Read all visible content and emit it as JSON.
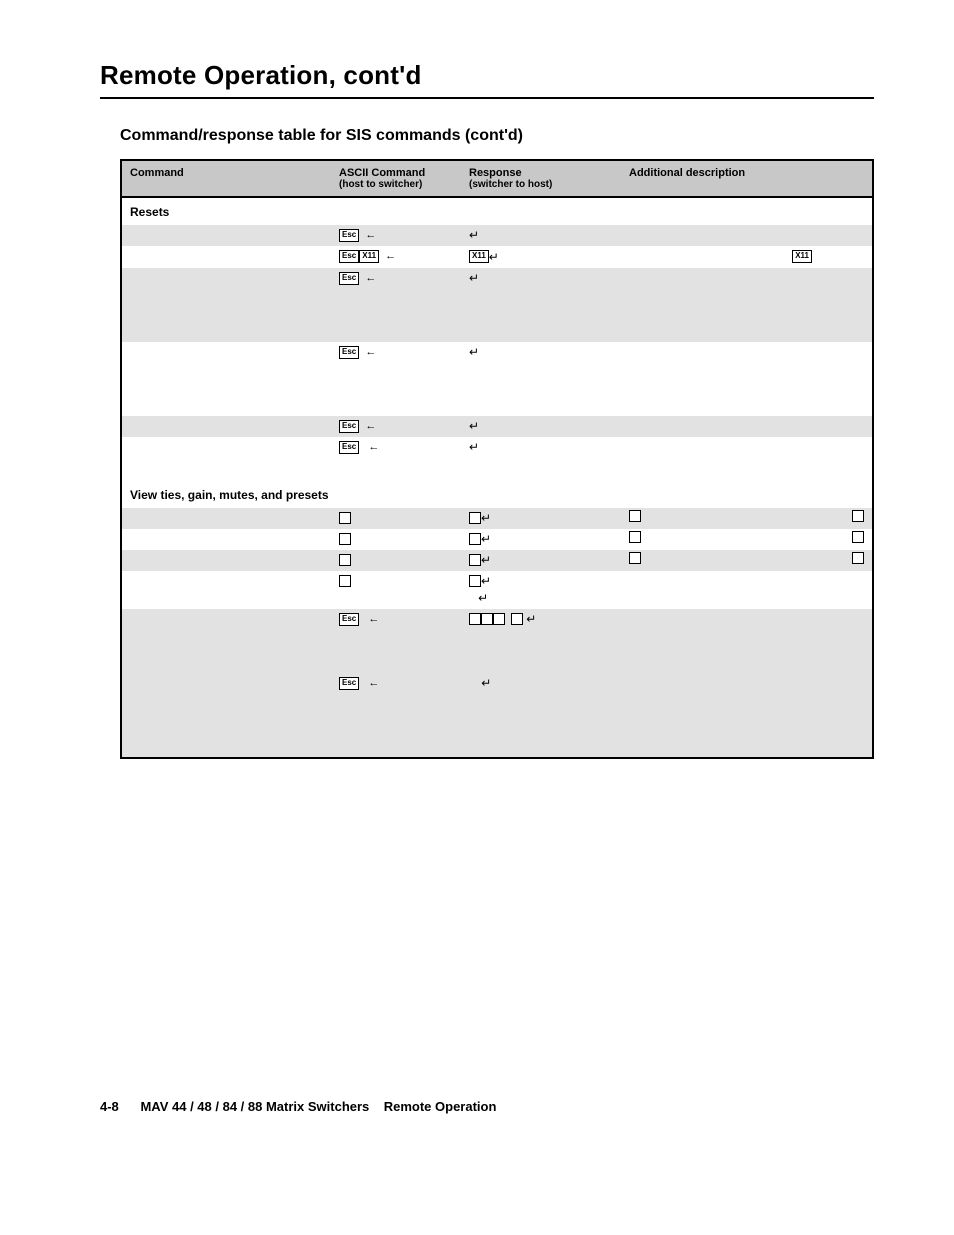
{
  "page_title": "Remote Operation, cont'd",
  "subtitle": "Command/response table for SIS commands (cont'd)",
  "headers": {
    "command": "Command",
    "ascii": "ASCII Command",
    "ascii_sub": "(host to switcher)",
    "response": "Response",
    "response_sub": "(switcher to host)",
    "desc": "Additional description"
  },
  "glyphs": {
    "esc": "Esc",
    "x11": "X11",
    "enter": "↵",
    "larrow": "←"
  },
  "sections": [
    {
      "label": "Resets"
    },
    {
      "label": "View ties, gain, mutes, and presets"
    }
  ],
  "footer": {
    "pg": "4-8",
    "product": "MAV 44 / 48 / 84 / 88 Matrix Switchers",
    "section": "Remote Operation"
  },
  "chart_data": {
    "type": "table",
    "title": "Command/response table for SIS commands (cont'd)",
    "columns": [
      "Command",
      "ASCII Command (host to switcher)",
      "Response (switcher to host)",
      "Additional description"
    ],
    "rows": [
      {
        "section": "Resets"
      },
      {
        "command": "",
        "ascii": "[Esc] ←",
        "response": "↵",
        "desc": ""
      },
      {
        "command": "",
        "ascii": "[Esc][X11] ←",
        "response": "[X11]↵",
        "desc": "[X11]"
      },
      {
        "command": "",
        "ascii": "[Esc] ←",
        "response": "↵",
        "desc": "",
        "multiline": 4
      },
      {
        "command": "",
        "ascii": "[Esc] ←",
        "response": "↵",
        "desc": "",
        "multiline": 4
      },
      {
        "command": "",
        "ascii": "[Esc] ←",
        "response": "↵",
        "desc": ""
      },
      {
        "command": "",
        "ascii": "[Esc] ←",
        "response": "↵",
        "desc": "",
        "multiline": 2
      },
      {
        "section": "View ties, gain, mutes, and presets"
      },
      {
        "command": "",
        "ascii": "□",
        "response": "□↵",
        "desc": "□ … □"
      },
      {
        "command": "",
        "ascii": "□",
        "response": "□↵",
        "desc": "□ … □"
      },
      {
        "command": "",
        "ascii": "□",
        "response": "□↵",
        "desc": "□ … □"
      },
      {
        "command": "",
        "ascii": "□",
        "response": "□↵ / ↵",
        "desc": ""
      },
      {
        "command": "",
        "ascii": "[Esc] ←",
        "response": "□□□ □↵",
        "desc": "",
        "multiline": 3
      },
      {
        "command": "",
        "ascii": "[Esc] ←",
        "response": "↵",
        "desc": "",
        "multiline": 4
      }
    ]
  }
}
